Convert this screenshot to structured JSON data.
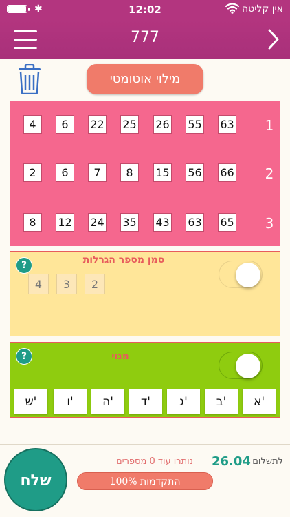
{
  "status_bar": {
    "time": "12:02",
    "carrier": "אין קליטה",
    "bluetooth": "✱"
  },
  "header": {
    "title": "777",
    "menu_icon": "hamburger-icon",
    "back_icon": "chevron-right-icon"
  },
  "toolbar": {
    "auto_fill_label": "מילוי אוטומטי",
    "trash_icon": "trash-icon"
  },
  "numbers": {
    "rows": [
      {
        "label": "1",
        "values": [
          "63",
          "55",
          "26",
          "25",
          "22",
          "6",
          "4"
        ]
      },
      {
        "label": "2",
        "values": [
          "66",
          "56",
          "15",
          "8",
          "7",
          "6",
          "2"
        ]
      },
      {
        "label": "3",
        "values": [
          "65",
          "63",
          "43",
          "35",
          "24",
          "12",
          "8"
        ]
      }
    ]
  },
  "draws": {
    "title": "סמן מספר הגרלות",
    "help": "?",
    "options": [
      "2",
      "3",
      "4"
    ],
    "toggle_on": true
  },
  "subscription": {
    "title": "מנוי",
    "help": "?",
    "toggle_on": true,
    "days": [
      "א'",
      "ב'",
      "ג'",
      "ד'",
      "ה'",
      "ו'",
      "ש'"
    ]
  },
  "footer": {
    "send_label": "שלח",
    "remaining_text": "נותרו עוד 0 מספרים",
    "payment_label": "לתשלום",
    "payment_amount": "26.04",
    "progress_text": "100% התקדמות",
    "progress_fraction": 1.0
  },
  "colors": {
    "header": "#b3357f",
    "numbers_panel": "#f5678e",
    "draws_panel": "#ffe699",
    "subscription_panel": "#8fcc0f",
    "accent": "#1f9c87",
    "button": "#f07b6a"
  }
}
